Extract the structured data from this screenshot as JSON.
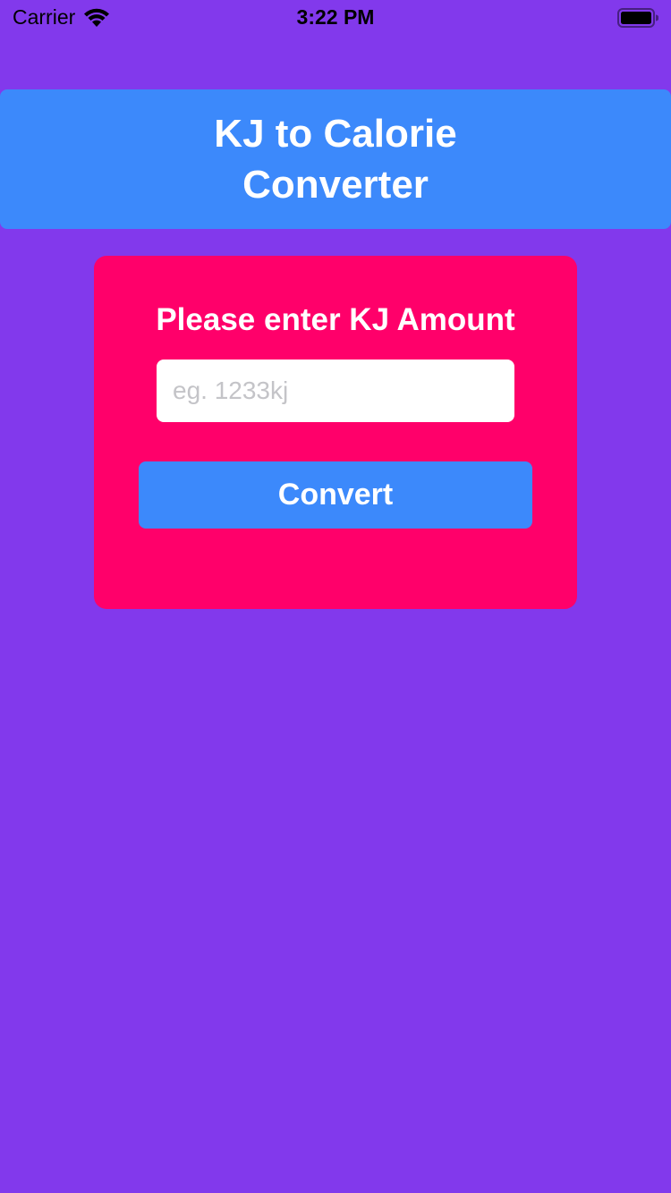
{
  "status_bar": {
    "carrier": "Carrier",
    "time": "3:22 PM"
  },
  "header": {
    "title": "KJ to Calorie Converter"
  },
  "card": {
    "prompt": "Please enter KJ Amount",
    "input": {
      "value": "",
      "placeholder": "eg. 1233kj"
    },
    "convert_label": "Convert"
  },
  "colors": {
    "background": "#8239EC",
    "header": "#3C89FB",
    "card": "#FF006A",
    "button": "#3C89FB"
  }
}
